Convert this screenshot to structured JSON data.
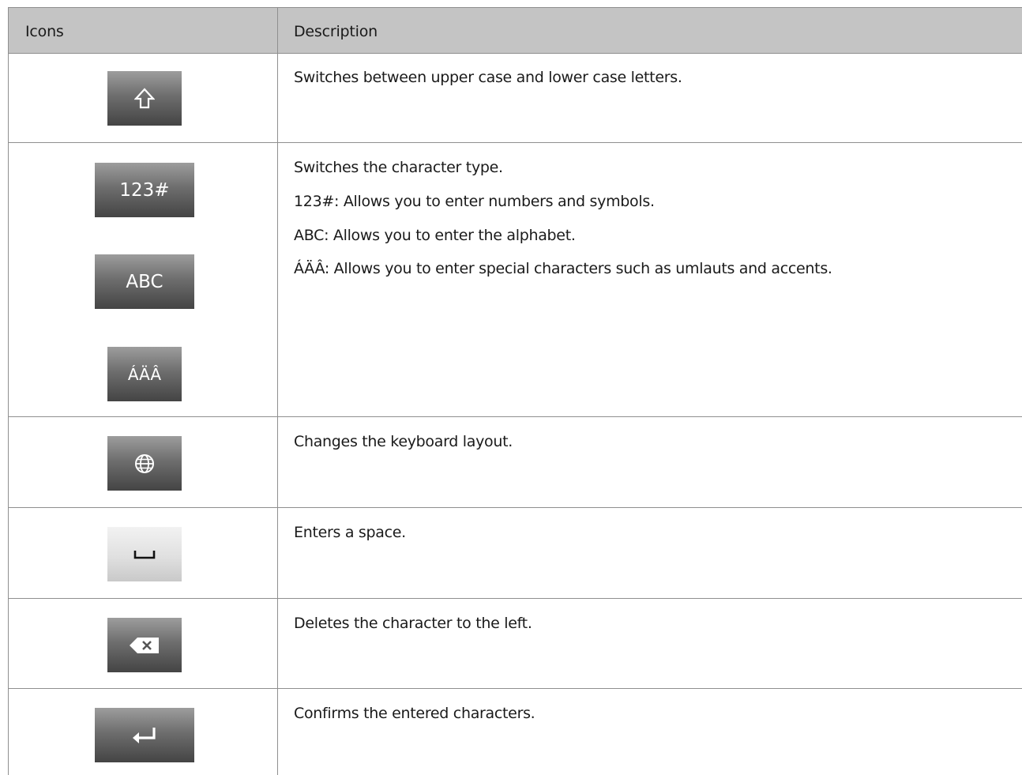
{
  "table": {
    "headers": {
      "icons": "Icons",
      "description": "Description"
    },
    "rows": [
      {
        "icon_names": [
          "shift-arrow-icon"
        ],
        "description": [
          "Switches between upper case and lower case letters."
        ]
      },
      {
        "icon_labels": [
          "123#",
          "ABC",
          "ÁÄÂ"
        ],
        "description": [
          "Switches the character type.",
          "123#: Allows you to enter numbers and symbols.",
          "ABC: Allows you to enter the alphabet.",
          "ÁÄÂ: Allows you to enter special characters such as umlauts and accents."
        ]
      },
      {
        "icon_names": [
          "globe-icon"
        ],
        "description": [
          "Changes the keyboard layout."
        ]
      },
      {
        "icon_names": [
          "space-icon"
        ],
        "description": [
          "Enters a space."
        ]
      },
      {
        "icon_names": [
          "backspace-icon"
        ],
        "description": [
          "Deletes the character to the left."
        ]
      },
      {
        "icon_names": [
          "enter-icon"
        ],
        "description": [
          "Confirms the entered characters."
        ]
      }
    ]
  },
  "colors": {
    "header_background": "#c4c4c4",
    "border": "#8f8f8f",
    "key_dark_top": "#9d9d9d",
    "key_dark_bottom": "#444444",
    "key_light_top": "#f2f2f2",
    "key_light_bottom": "#c9c9c9"
  }
}
